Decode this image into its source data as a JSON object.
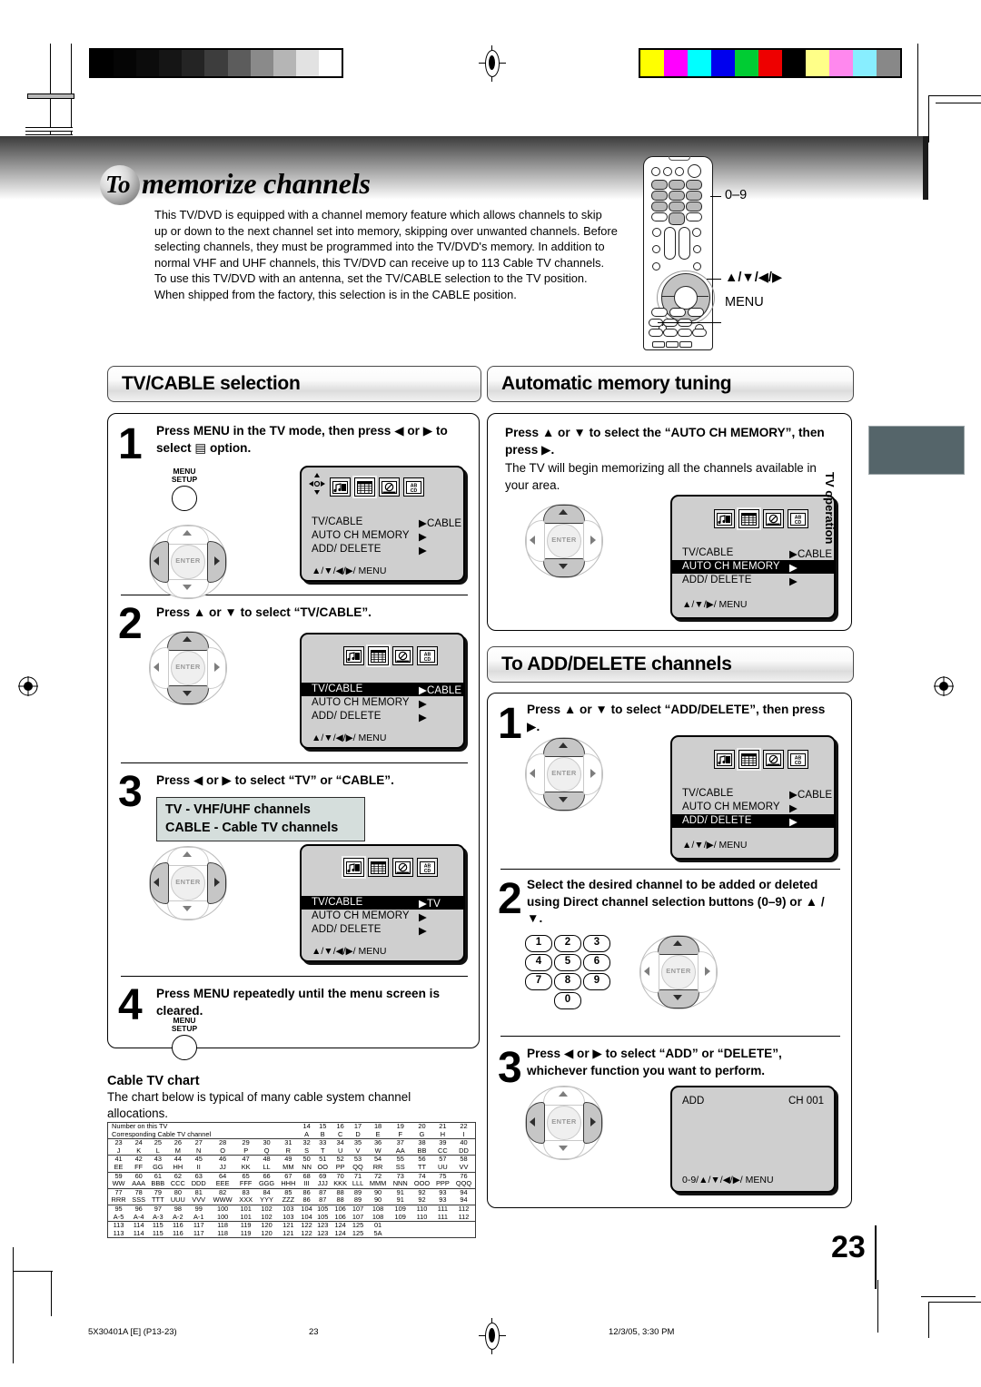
{
  "document": {
    "title_badge": "To",
    "title": "memorize channels",
    "intro": "This TV/DVD is equipped with a channel memory feature which allows channels to skip up or down to the next channel set into memory, skipping over unwanted channels. Before selecting channels, they must be programmed into the TV/DVD's memory. In addition to normal VHF and UHF channels, this TV/DVD can receive up to 113 Cable TV channels. To use this TV/DVD with an antenna, set the TV/CABLE selection to the TV position. When shipped from the factory, this selection is in the CABLE position.",
    "page_number": "23",
    "side_tab": "TV operation"
  },
  "remote": {
    "callouts": [
      {
        "label": "0–9"
      },
      {
        "label": "▲/▼/◀/▶"
      },
      {
        "label": "MENU"
      }
    ]
  },
  "sections": {
    "tv_cable": {
      "banner": "TV/CABLE selection",
      "steps": [
        {
          "num": "1",
          "text": "Press MENU in the TV mode, then press ◀ or ▶ to select ▤ option.",
          "button": {
            "line1": "MENU",
            "line2": "SETUP"
          }
        },
        {
          "num": "2",
          "text": "Press ▲ or ▼ to select “TV/CABLE”."
        },
        {
          "num": "3",
          "text": "Press ◀ or ▶ to select “TV” or “CABLE”.",
          "callout": [
            "TV - VHF/UHF channels",
            "CABLE - Cable TV channels"
          ]
        },
        {
          "num": "4",
          "text": "Press MENU repeatedly until the menu screen is cleared.",
          "button": {
            "line1": "MENU",
            "line2": "SETUP"
          }
        }
      ]
    },
    "auto_memory": {
      "banner": "Automatic memory tuning",
      "step_bold": "Press ▲ or ▼ to select the “AUTO CH MEMORY”, then press ▶.",
      "step_normal": "The TV will begin memorizing all the channels available in your area."
    },
    "add_delete": {
      "banner": "To ADD/DELETE channels",
      "steps": [
        {
          "num": "1",
          "text": "Press ▲ or ▼ to select “ADD/DELETE”, then press ▶."
        },
        {
          "num": "2",
          "text": "Select the desired channel to be added or deleted using Direct channel selection buttons (0–9) or ▲ / ▼."
        },
        {
          "num": "3",
          "text": "Press ◀ or ▶ to select “ADD” or “DELETE”, whichever function you want to perform."
        }
      ],
      "keypad": [
        "1",
        "2",
        "3",
        "4",
        "5",
        "6",
        "7",
        "8",
        "9",
        "0"
      ]
    }
  },
  "osd_icons": {
    "picture": "♪",
    "channel": "grid",
    "clock": "⊘",
    "caption": "AB\nCD"
  },
  "osd_screens": {
    "step1": {
      "rows": [
        {
          "label": "TV/CABLE",
          "value": "▶CABLE",
          "highlight": false
        },
        {
          "label": "AUTO  CH  MEMORY",
          "value": "▶",
          "highlight": false
        },
        {
          "label": "ADD/ DELETE",
          "value": "▶",
          "highlight": false
        }
      ],
      "footer": "▲/▼/◀/▶/ MENU",
      "selected_icon": 1
    },
    "step2": {
      "rows": [
        {
          "label": "TV/CABLE",
          "value": "▶CABLE",
          "highlight": true
        },
        {
          "label": "AUTO  CH  MEMORY",
          "value": "▶",
          "highlight": false
        },
        {
          "label": "ADD/ DELETE",
          "value": "▶",
          "highlight": false
        }
      ],
      "footer": "▲/▼/◀/▶/ MENU",
      "selected_icon": 2
    },
    "step3": {
      "rows": [
        {
          "label": "TV/CABLE",
          "value": "▶TV",
          "highlight": true
        },
        {
          "label": "AUTO  CH  MEMORY",
          "value": "▶",
          "highlight": false
        },
        {
          "label": "ADD/ DELETE",
          "value": "▶",
          "highlight": false
        }
      ],
      "footer": "▲/▼/◀/▶/ MENU",
      "selected_icon": 1
    },
    "auto": {
      "rows": [
        {
          "label": "TV/CABLE",
          "value": "▶CABLE",
          "highlight": false
        },
        {
          "label": "AUTO  CH  MEMORY",
          "value": "▶",
          "highlight": true
        },
        {
          "label": "ADD/ DELETE",
          "value": "▶",
          "highlight": false
        }
      ],
      "footer": "▲/▼/▶/ MENU",
      "selected_icon": 1
    },
    "adddel": {
      "rows": [
        {
          "label": "TV/CABLE",
          "value": "▶CABLE",
          "highlight": false
        },
        {
          "label": "AUTO  CH  MEMORY",
          "value": "▶",
          "highlight": false
        },
        {
          "label": "ADD/ DELETE",
          "value": "▶",
          "highlight": true
        }
      ],
      "footer": "▲/▼/▶/ MENU",
      "selected_icon": 1
    },
    "add_confirm": {
      "mode": "ADD",
      "channel": "CH 001",
      "footer": "0-9/▲/▼/◀/▶/ MENU"
    }
  },
  "cable_chart": {
    "title": "Cable TV chart",
    "description": "The chart below is typical of many cable system channel allocations.",
    "header_line1": "Number on this TV",
    "header_line2": "Corresponding Cable TV channel",
    "rows": [
      {
        "tv": [
          "14",
          "15",
          "16",
          "17",
          "18",
          "19",
          "20",
          "21",
          "22"
        ],
        "cable": [
          "A",
          "B",
          "C",
          "D",
          "E",
          "F",
          "G",
          "H",
          "I"
        ],
        "offset": 9
      },
      {
        "tv": [
          "23",
          "24",
          "25",
          "26",
          "27",
          "28",
          "29",
          "30",
          "31",
          "32",
          "33",
          "34",
          "35",
          "36",
          "37",
          "38",
          "39",
          "40"
        ],
        "cable": [
          "J",
          "K",
          "L",
          "M",
          "N",
          "O",
          "P",
          "Q",
          "R",
          "S",
          "T",
          "U",
          "V",
          "W",
          "AA",
          "BB",
          "CC",
          "DD"
        ],
        "offset": 0
      },
      {
        "tv": [
          "41",
          "42",
          "43",
          "44",
          "45",
          "46",
          "47",
          "48",
          "49",
          "50",
          "51",
          "52",
          "53",
          "54",
          "55",
          "56",
          "57",
          "58"
        ],
        "cable": [
          "EE",
          "FF",
          "GG",
          "HH",
          "II",
          "JJ",
          "KK",
          "LL",
          "MM",
          "NN",
          "OO",
          "PP",
          "QQ",
          "RR",
          "SS",
          "TT",
          "UU",
          "VV"
        ],
        "offset": 0
      },
      {
        "tv": [
          "59",
          "60",
          "61",
          "62",
          "63",
          "64",
          "65",
          "66",
          "67",
          "68",
          "69",
          "70",
          "71",
          "72",
          "73",
          "74",
          "75",
          "76"
        ],
        "cable": [
          "WW",
          "AAA",
          "BBB",
          "CCC",
          "DDD",
          "EEE",
          "FFF",
          "GGG",
          "HHH",
          "III",
          "JJJ",
          "KKK",
          "LLL",
          "MMM",
          "NNN",
          "OOO",
          "PPP",
          "QQQ"
        ],
        "offset": 0
      },
      {
        "tv": [
          "77",
          "78",
          "79",
          "80",
          "81",
          "82",
          "83",
          "84",
          "85",
          "86",
          "87",
          "88",
          "89",
          "90",
          "91",
          "92",
          "93",
          "94"
        ],
        "cable": [
          "RRR",
          "SSS",
          "TTT",
          "UUU",
          "VVV",
          "WWW",
          "XXX",
          "YYY",
          "ZZZ",
          "86",
          "87",
          "88",
          "89",
          "90",
          "91",
          "92",
          "93",
          "94"
        ],
        "offset": 0
      },
      {
        "tv": [
          "95",
          "96",
          "97",
          "98",
          "99",
          "100",
          "101",
          "102",
          "103",
          "104",
          "105",
          "106",
          "107",
          "108",
          "109",
          "110",
          "111",
          "112"
        ],
        "cable": [
          "A-5",
          "A-4",
          "A-3",
          "A-2",
          "A-1",
          "100",
          "101",
          "102",
          "103",
          "104",
          "105",
          "106",
          "107",
          "108",
          "109",
          "110",
          "111",
          "112"
        ],
        "offset": 0
      },
      {
        "tv": [
          "113",
          "114",
          "115",
          "116",
          "117",
          "118",
          "119",
          "120",
          "121",
          "122",
          "123",
          "124",
          "125",
          "01"
        ],
        "cable": [
          "113",
          "114",
          "115",
          "116",
          "117",
          "118",
          "119",
          "120",
          "121",
          "122",
          "123",
          "124",
          "125",
          "5A"
        ],
        "offset": 0
      }
    ]
  },
  "footer": {
    "part_number": "5X30401A [E] (P13-23)",
    "page": "23",
    "timestamp": "12/3/05, 3:30 PM"
  },
  "colors": {
    "banner_edge": "#4a4a4a",
    "osd_bg": "#cfcfcf",
    "callout_bg": "#d5dedc",
    "side_tab": "#55656a"
  }
}
